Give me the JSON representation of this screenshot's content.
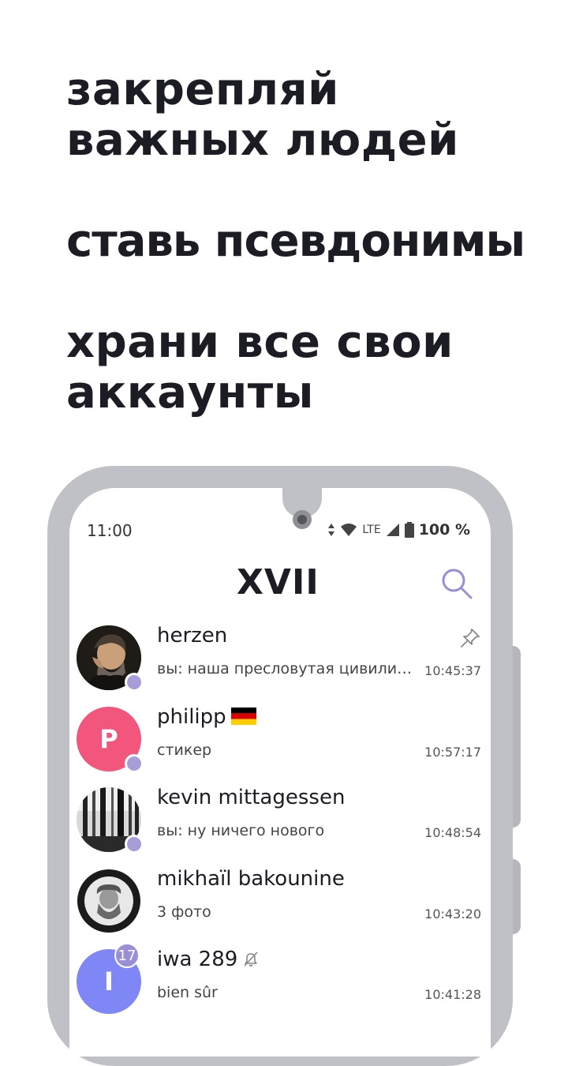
{
  "promo": {
    "lines": [
      "закрепляй",
      "важных людей",
      "ставь псевдонимы",
      "храни все свои",
      "аккаунты"
    ]
  },
  "status_bar": {
    "time": "11:00",
    "network": "LTE",
    "battery": "100 %"
  },
  "app": {
    "logo": "XVII",
    "accent_color": "#9a8fd6"
  },
  "chats": [
    {
      "name": "herzen",
      "preview": "вы: наша пресловутая цивилизация",
      "time": "10:45:37",
      "pinned": true,
      "online": true,
      "avatar": "photo"
    },
    {
      "name": "philipp",
      "preview": "стикер",
      "time": "10:57:17",
      "online": true,
      "avatar_letter": "P",
      "avatar_color": "#f2567c",
      "flag": "germany-flag"
    },
    {
      "name": "kevin mittagessen",
      "preview": "вы: ну ничего нового",
      "time": "10:48:54",
      "online": true,
      "avatar": "photo"
    },
    {
      "name": "mikhaïl bakounine",
      "preview": "3 фото",
      "time": "10:43:20",
      "avatar": "photo"
    },
    {
      "name": "iwa 289",
      "preview": "bien sûr",
      "time": "10:41:28",
      "avatar_letter": "I",
      "avatar_color": "#7f86f5",
      "unread": "17",
      "muted": true
    }
  ]
}
